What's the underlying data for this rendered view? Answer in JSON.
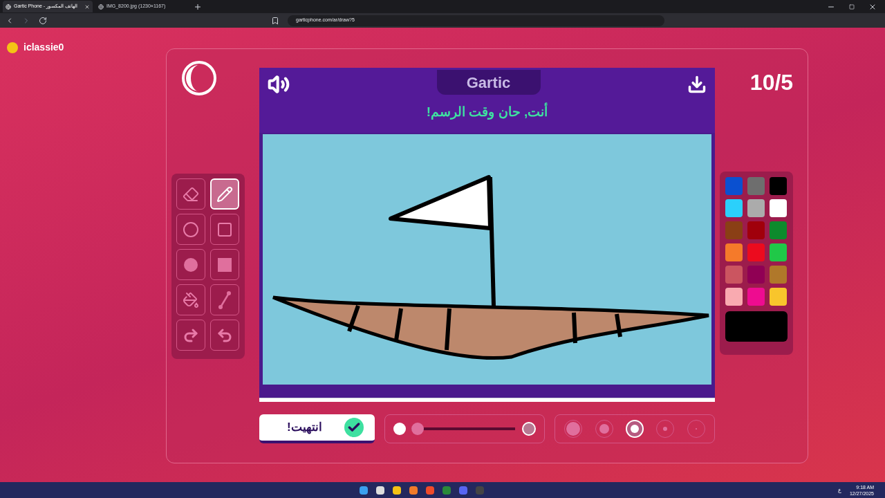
{
  "browser": {
    "tabs": [
      {
        "title": "Gartic Phone - الهاتف المكسور",
        "selected": true
      },
      {
        "title": "IMG_8200.jpg (1230×1167)",
        "selected": false
      }
    ],
    "address": "garticphone.com/ar/draw?5"
  },
  "user": {
    "name": "iclassie0"
  },
  "game": {
    "round": "10/5",
    "logo": "Gartic",
    "prompt": "أنت, حان وقت الرسم!",
    "tools": [
      {
        "kind": "eraser",
        "selected": false
      },
      {
        "kind": "pencil",
        "selected": true
      },
      {
        "kind": "ellipse",
        "selected": false
      },
      {
        "kind": "rectangle",
        "selected": false
      },
      {
        "kind": "filled-ellipse",
        "selected": false
      },
      {
        "kind": "filled-rectangle",
        "selected": false
      },
      {
        "kind": "bucket",
        "selected": false
      },
      {
        "kind": "line",
        "selected": false
      },
      {
        "kind": "redo",
        "selected": false
      },
      {
        "kind": "undo",
        "selected": false
      }
    ],
    "palette": [
      {
        "color": "#0a50d0"
      },
      {
        "color": "#6e6e6e"
      },
      {
        "color": "#000000"
      },
      {
        "color": "#2bd0fb"
      },
      {
        "color": "#ababab"
      },
      {
        "color": "#ffffff"
      },
      {
        "color": "#8a3f15"
      },
      {
        "color": "#a0000b"
      },
      {
        "color": "#0d8a2c"
      },
      {
        "color": "#f57a2a"
      },
      {
        "color": "#ec0b1e"
      },
      {
        "color": "#20c848"
      },
      {
        "color": "#cb5560"
      },
      {
        "color": "#900054"
      },
      {
        "color": "#b0782a"
      },
      {
        "color": "#f9aab0"
      },
      {
        "color": "#ee0c90"
      },
      {
        "color": "#f8c52c"
      }
    ],
    "current": {
      "color": "#000000"
    },
    "opacity": {
      "level": 0
    },
    "sizes": [
      {
        "selected": false
      },
      {
        "selected": false
      },
      {
        "selected": true
      },
      {
        "selected": false
      },
      {
        "selected": false
      }
    ],
    "done_label": "انتهيت!"
  },
  "taskbar": {
    "lang": "ع",
    "time": "9:18 AM",
    "date": "12/27/2025"
  }
}
